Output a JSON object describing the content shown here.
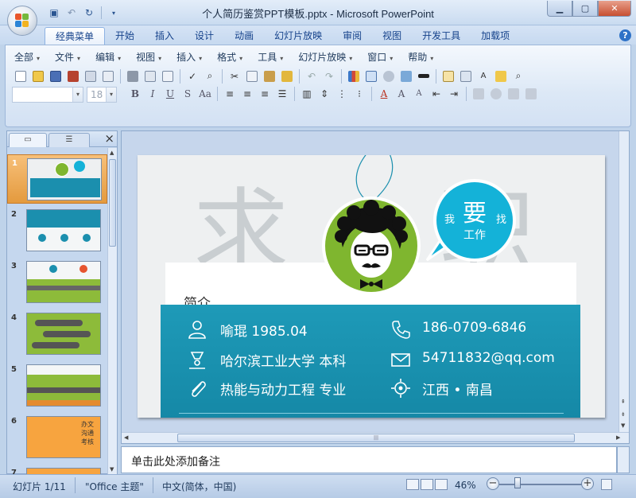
{
  "window": {
    "title": "个人简历鉴赏PPT模板.pptx - Microsoft PowerPoint",
    "controls": [
      "minimize",
      "maximize",
      "close"
    ]
  },
  "ribbon": {
    "tabs": [
      "经典菜单",
      "开始",
      "插入",
      "设计",
      "动画",
      "幻灯片放映",
      "审阅",
      "视图",
      "开发工具",
      "加载项"
    ],
    "active_tab": "经典菜单",
    "classic_menu": [
      "全部",
      "文件",
      "编辑",
      "视图",
      "插入",
      "格式",
      "工具",
      "幻灯片放映",
      "窗口",
      "帮助"
    ],
    "font_size": "18"
  },
  "thumbnails": {
    "numbers": [
      "1",
      "2",
      "3",
      "4",
      "5",
      "6",
      "7"
    ],
    "selected": "1",
    "slide6_texts": [
      "办文",
      "沟通",
      "考核"
    ]
  },
  "slide": {
    "bg_chars": [
      "求",
      "职"
    ],
    "bubble": {
      "big": "要",
      "small": "工作",
      "left": "我",
      "right": "找"
    },
    "intro": "简介",
    "info": {
      "name_age": "喻琨  1985.04",
      "school": "哈尔滨工业大学 本科",
      "major": "热能与动力工程 专业",
      "phone": "186-0709-6846",
      "email": "54711832@qq.com",
      "location": "江西 • 南昌"
    },
    "colors": {
      "band": "#1788a7",
      "bubble": "#14b2d8",
      "avatar": "#7fb62f"
    }
  },
  "notes": {
    "placeholder": "单击此处添加备注"
  },
  "status": {
    "slide_info": "幻灯片 1/11",
    "theme": "\"Office 主题\"",
    "language": "中文(简体，中国)",
    "zoom": "46%"
  }
}
